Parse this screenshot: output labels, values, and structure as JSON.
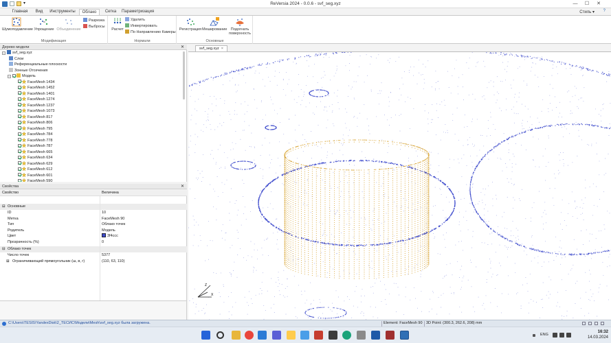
{
  "window": {
    "title": "ReVersia 2024 - 0.0.6 - svf_seg.xyz",
    "minimize": "—",
    "maximize": "☐",
    "close": "✕"
  },
  "ribbon_tabs": [
    "Главная",
    "Вид",
    "Инструменты",
    "Облако",
    "Сетка",
    "Параметризация"
  ],
  "style_label": "Стиль",
  "ribbon": {
    "modify": {
      "name": "Модификация",
      "denoise": "Шумоподавление",
      "simplify": "Упрощение",
      "merge": "Объединение",
      "sections": "Разрезка",
      "outliers": "Выбросы"
    },
    "normals": {
      "name": "Нормали",
      "compute": "Расчет",
      "delete": "Удалить",
      "invert": "Инвертировать",
      "by_camera": "По Направлению Камеры"
    },
    "main": {
      "name": "Основные",
      "registration": "Регистрация",
      "meshing": "Меширование",
      "fit_line1": "Подогнать",
      "fit_line2": "поверхность"
    }
  },
  "tree_panel": {
    "title": "Дерево модели",
    "root": "svf_seg.xyz",
    "nodes": [
      "Слои",
      "Референциальные плоскости",
      "Зонные Отсечения"
    ],
    "model": "Модель",
    "items": [
      "FaceMesh 1434",
      "FaceMesh 1452",
      "FaceMesh 1401",
      "FaceMesh 1274",
      "FaceMesh 1237",
      "FaceMesh 1073",
      "FaceMesh 817",
      "FaceMesh 806",
      "FaceMesh 795",
      "FaceMesh 784",
      "FaceMesh 778",
      "FaceMesh 787",
      "FaceMesh 665",
      "FaceMesh 634",
      "FaceMesh 629",
      "FaceMesh 612",
      "FaceMesh 601",
      "FaceMesh 590"
    ]
  },
  "props_panel": {
    "title": "Свойства",
    "col_property": "Свойство",
    "col_value": "Величина",
    "group_main": "Основные",
    "rows": [
      {
        "key": "ID",
        "value": "10"
      },
      {
        "key": "Метка",
        "value": "FaceMesh 90"
      },
      {
        "key": "Тип",
        "value": "Облако точек"
      },
      {
        "key": "Родитель",
        "value": "Модель"
      },
      {
        "key": "Цвет",
        "value": "3f4ccc"
      },
      {
        "key": "Прозрачность (%)",
        "value": "0"
      }
    ],
    "group_cloud": "Облако точек",
    "cloud_rows": [
      {
        "key": "Число точек",
        "value": "5377"
      },
      {
        "key": "Ограничивающий прямоугольник (ш, в, г)",
        "value": "(110, 63, 110)"
      }
    ]
  },
  "doc_tab": {
    "label": "svf_seg.xyz",
    "close": "×"
  },
  "status": {
    "message": "C:\\Users\\TESIS\\YandexDisk\\2_ТЕСИС\\Модели\\Mesh\\svf_seg.xyz была загружена.",
    "element": "Element: FaceMesh 90",
    "point": "3D Point: (300.3, 262.6, 208) mm"
  },
  "taskbar": {
    "lang": "ENG",
    "time": "16:32",
    "date": "14.03.2024"
  },
  "colors": {
    "point_cloud": "#3f4ccc",
    "selected_cloud": "#d49a1c",
    "accent": "#2f6fb5"
  }
}
